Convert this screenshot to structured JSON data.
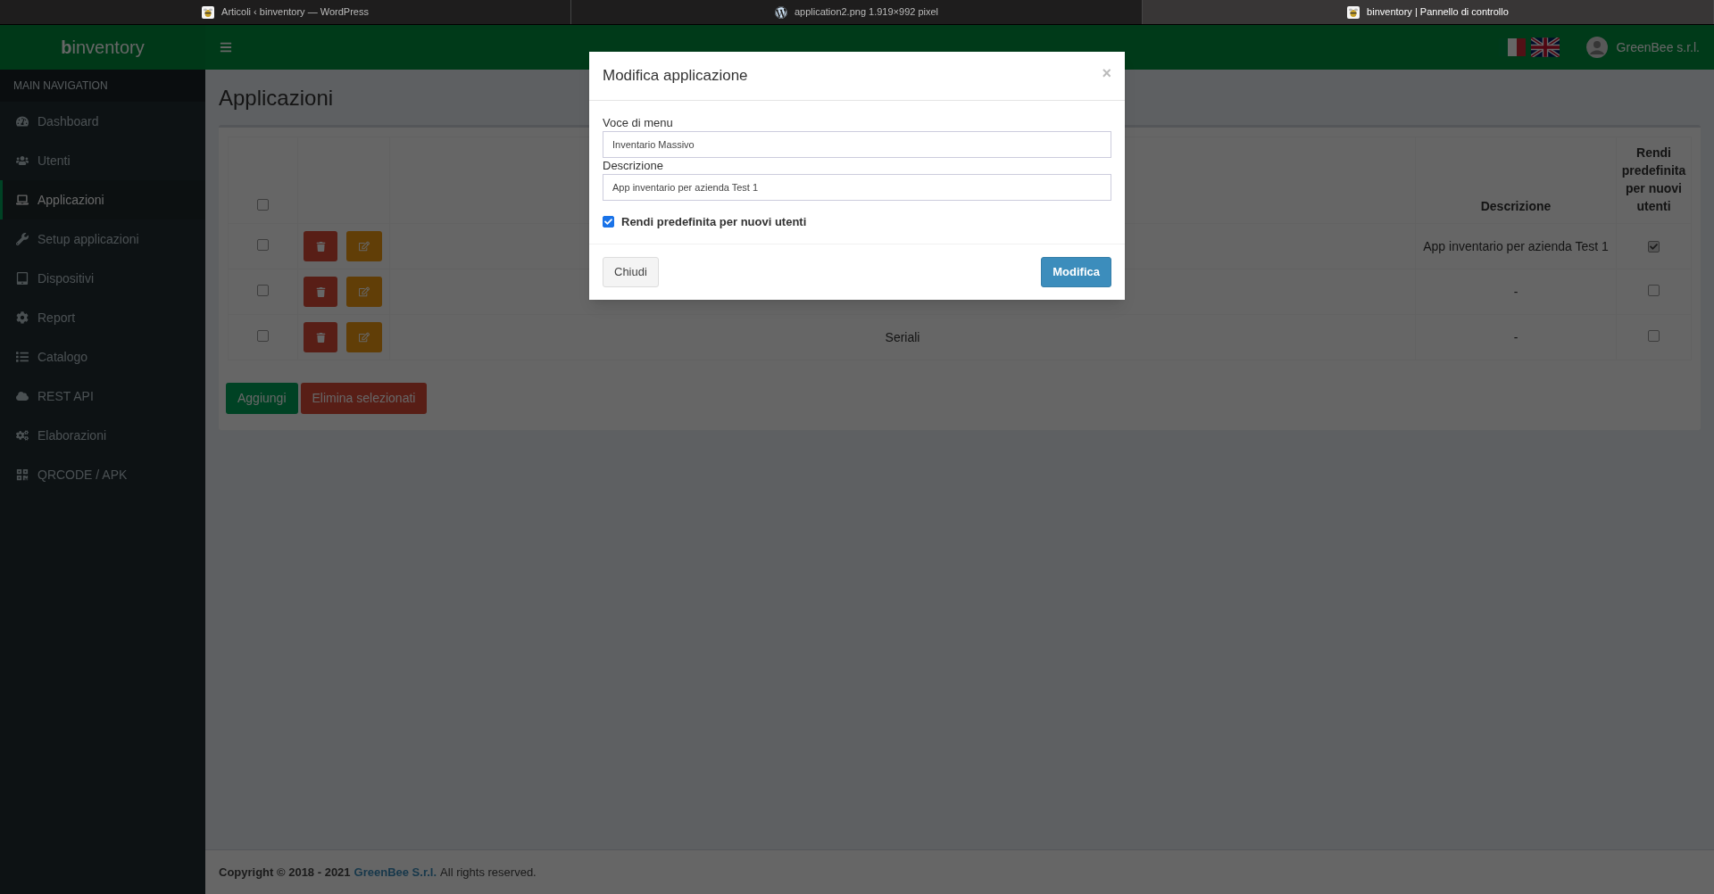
{
  "browser_tabs": [
    {
      "label": "Articoli ‹ binventory — WordPress",
      "selected": false
    },
    {
      "label": "application2.png 1.919×992 pixel",
      "selected": false
    },
    {
      "label": "binventory | Pannello di controllo",
      "selected": true
    }
  ],
  "header": {
    "logo": "**b**inventory",
    "user": "GreenBee s.r.l."
  },
  "sidebar": {
    "heading": "MAIN NAVIGATION",
    "items": [
      {
        "label": "Dashboard",
        "selected": false
      },
      {
        "label": "Utenti",
        "selected": false
      },
      {
        "label": "Applicazioni",
        "selected": true
      },
      {
        "label": "Setup applicazioni",
        "selected": false
      },
      {
        "label": "Dispositivi",
        "selected": false
      },
      {
        "label": "Report",
        "selected": false
      },
      {
        "label": "Catalogo",
        "selected": false
      },
      {
        "label": "REST API",
        "selected": false
      },
      {
        "label": "Elaborazioni",
        "selected": false
      },
      {
        "label": "QRCODE / APK",
        "selected": false
      }
    ]
  },
  "page_title": "Applicazioni",
  "table": {
    "select_all_checked": false,
    "columns": [
      "Descrizione",
      "Rendi predefinita per nuovi utenti"
    ],
    "rows": [
      {
        "checked": false,
        "description": "App inventario per azienda Test 1",
        "default": true
      },
      {
        "checked": false,
        "description": "-",
        "default": false
      },
      {
        "checked": false,
        "name": "Seriali",
        "description": "-",
        "default": false
      }
    ]
  },
  "actions": [
    "Aggiungi",
    "Elimina selezionati"
  ],
  "footer": {
    "copyright": "Copyright © 2018 - 2021",
    "company": "GreenBee S.r.l.",
    "rights": "All rights reserved."
  },
  "modal": {
    "title": "Modifica applicazione",
    "close": "×",
    "fields": [
      {
        "label": "Voce di menu",
        "value": "Inventario Massivo"
      },
      {
        "label": "Descrizione",
        "value": "App inventario per azienda Test 1"
      }
    ],
    "checkbox": {
      "label": "Rendi predefinita per nuovi utenti",
      "checked": true
    },
    "buttons": [
      "Chiudi",
      "Modifica"
    ]
  }
}
